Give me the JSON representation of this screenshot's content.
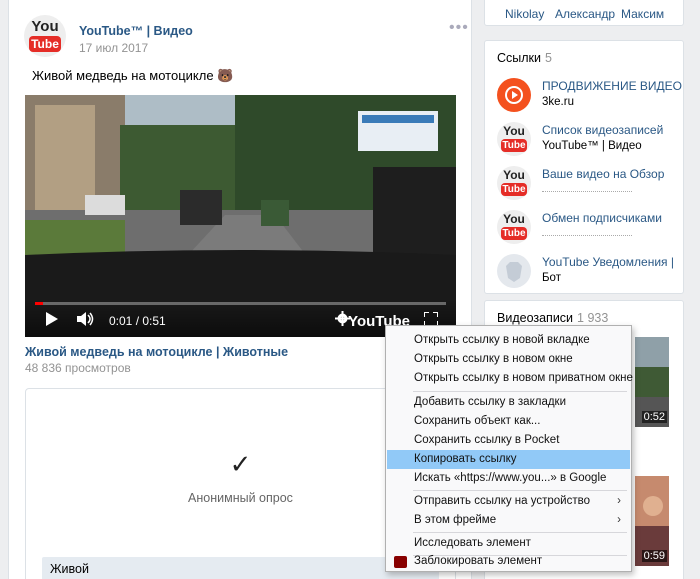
{
  "post": {
    "author": "YouTube™ | Видео",
    "date": "17 июл 2017",
    "more": "•••",
    "text": "Живой медведь на мотоцикле 🐻",
    "video": {
      "time": "0:01 / 0:51",
      "brand": "YouTube",
      "progress": 0.02,
      "title": "Живой медведь на мотоцикле | Животные",
      "views": "48 836 просмотров"
    },
    "poll": {
      "check": "✓",
      "label": "Анонимный опрос",
      "option": "Живой"
    }
  },
  "friends": [
    "Nikolay",
    "Александр",
    "Максим"
  ],
  "links": {
    "title": "Ссылки",
    "count": "5",
    "items": [
      {
        "title": "ПРОДВИЖЕНИЕ ВИДЕО",
        "sub": "3ke.ru",
        "icon": "play-circle-icon"
      },
      {
        "title": "Список видеозаписей",
        "sub": "YouTube™ | Видео",
        "icon": "youtube-logo-icon"
      },
      {
        "title": "Ваше видео на Обзор",
        "sub": "",
        "icon": "youtube-logo-icon"
      },
      {
        "title": "Обмен подписчиками",
        "sub": "",
        "icon": "youtube-logo-icon"
      },
      {
        "title": "YouTube Уведомления |",
        "sub": "Бот",
        "icon": "vk-dog-icon"
      }
    ]
  },
  "videos": {
    "title": "Видеозаписи",
    "count": "1 933",
    "durations": [
      "0:52",
      "0:59"
    ]
  },
  "context_menu": {
    "items": [
      {
        "label": "Открыть ссылку в новой вкладке"
      },
      {
        "label": "Открыть ссылку в новом окне"
      },
      {
        "label": "Открыть ссылку в новом приватном окне"
      },
      {
        "label": "Добавить ссылку в закладки"
      },
      {
        "label": "Сохранить объект как..."
      },
      {
        "label": "Сохранить ссылку в Pocket"
      },
      {
        "label": "Копировать ссылку"
      },
      {
        "label": "Искать «https://www.you...» в Google"
      },
      {
        "label": "Отправить ссылку на устройство",
        "arrow": "›"
      },
      {
        "label": "В этом фрейме",
        "arrow": "›"
      },
      {
        "label": "Исследовать элемент"
      },
      {
        "label": "Заблокировать элемент"
      }
    ]
  },
  "logo": {
    "you": "You",
    "tube": "Tube"
  },
  "colors": {
    "link": "#2a5885",
    "highlight": "#91c9f7",
    "yt_red": "#e52d27",
    "orange": "#f4511e"
  }
}
